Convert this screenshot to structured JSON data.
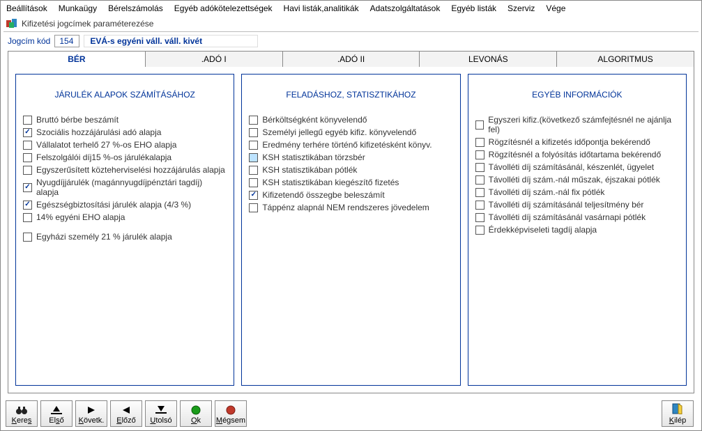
{
  "menubar": [
    "Beállítások",
    "Munkaügy",
    "Bérelszámolás",
    "Egyéb adókötelezettségek",
    "Havi listák,analitikák",
    "Adatszolgáltatások",
    "Egyéb listák",
    "Szerviz",
    "Vége"
  ],
  "window": {
    "title": "Kifizetési jogcímek paraméterezése"
  },
  "param": {
    "label": "Jogcím kód",
    "code": "154",
    "title": "EVÁ-s egyéni váll. váll. kivét"
  },
  "tabs": [
    {
      "label": "BÉR",
      "active": true
    },
    {
      "label": ".ADÓ I",
      "active": false
    },
    {
      "label": ".ADÓ II",
      "active": false
    },
    {
      "label": "LEVONÁS",
      "active": false
    },
    {
      "label": "ALGORITMUS",
      "active": false
    }
  ],
  "columns": [
    {
      "title": "JÁRULÉK ALAPOK SZÁMÍTÁSÁHOZ",
      "items": [
        {
          "label": "Bruttó bérbe beszámít",
          "checked": false
        },
        {
          "label": "Szociális hozzájárulási adó alapja",
          "checked": true
        },
        {
          "label": "Vállalatot terhelő 27 %-os EHO alapja",
          "checked": false
        },
        {
          "label": "Felszolgálói díj15 %-os járulékalapja",
          "checked": false
        },
        {
          "label": "Egyszerűsített közteherviselési hozzájárulás alapja",
          "checked": false
        },
        {
          "label": "Nyugdíjjárulék (magánnyugdíjpénztári tagdíj) alapja",
          "checked": true
        },
        {
          "label": "Egészségbiztosítási járulék alapja (4/3 %)",
          "checked": true
        },
        {
          "label": "14% egyéni EHO alapja",
          "checked": false
        },
        {
          "label": "Egyházi személy 21 % járulék alapja",
          "checked": false,
          "gap": true
        }
      ]
    },
    {
      "title": "FELADÁSHOZ, STATISZTIKÁHOZ",
      "items": [
        {
          "label": "Bérköltségként könyvelendő",
          "checked": false
        },
        {
          "label": "Személyi jellegű egyéb kifiz. könyvelendő",
          "checked": false
        },
        {
          "label": "Eredmény terhére történő kifizetésként könyv.",
          "checked": false
        },
        {
          "label": "KSH statisztikában törzsbér",
          "checked": false,
          "highlight": true
        },
        {
          "label": "KSH statisztikában pótlék",
          "checked": false
        },
        {
          "label": "KSH statisztikában kiegészítő fizetés",
          "checked": false
        },
        {
          "label": "Kifizetendő összegbe beleszámít",
          "checked": true
        },
        {
          "label": "Táppénz alapnál NEM rendszeres jövedelem",
          "checked": false
        }
      ]
    },
    {
      "title": "EGYÉB INFORMÁCIÓK",
      "items": [
        {
          "label": "Egyszeri kifiz.(következő számfejtésnél ne ajánlja fel)",
          "checked": false
        },
        {
          "label": "Rögzítésnél a kifizetés időpontja bekérendő",
          "checked": false
        },
        {
          "label": "Rögzítésnél a folyósítás időtartama bekérendő",
          "checked": false
        },
        {
          "label": "Távolléti díj számításánál, készenlét, ügyelet",
          "checked": false
        },
        {
          "label": "Távolléti díj szám.-nál műszak, éjszakai pótlék",
          "checked": false
        },
        {
          "label": "Távolléti díj szám.-nál fix pótlék",
          "checked": false
        },
        {
          "label": "Távolléti díj számításánál teljesítmény bér",
          "checked": false
        },
        {
          "label": "Távolléti díj számításánál vasárnapi pótlék",
          "checked": false
        },
        {
          "label": "Érdekképviseleti tagdíj alapja",
          "checked": false
        }
      ]
    }
  ],
  "toolbar": {
    "keres": "Keres",
    "elso": "Első",
    "kovetk": "Követk.",
    "elozo": "Előző",
    "utolso": "Utolsó",
    "ok": "Ok",
    "megsem": "Mégsem",
    "kilep": "Kilép"
  }
}
